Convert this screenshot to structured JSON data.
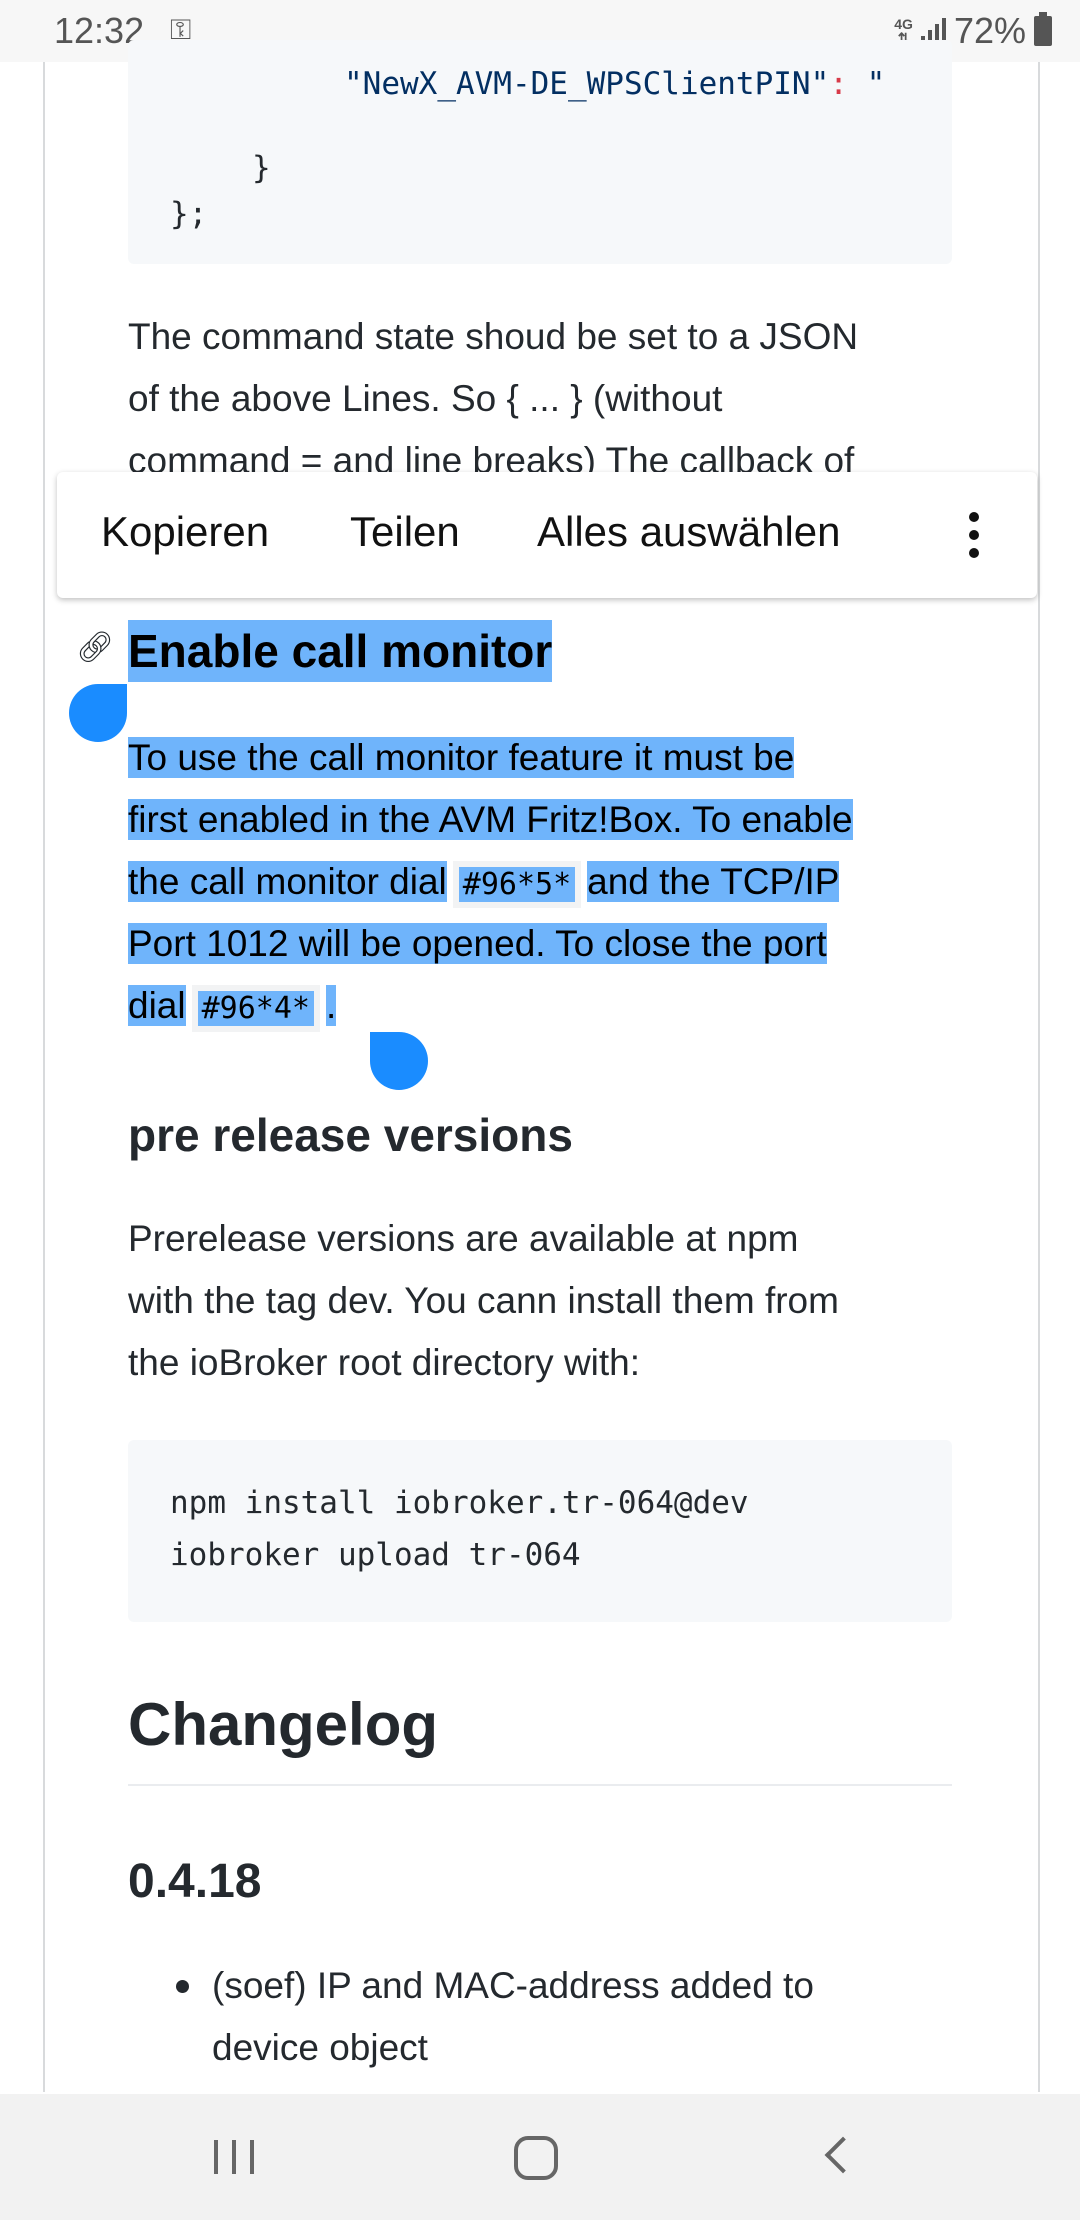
{
  "status_bar": {
    "time": "12:32",
    "network": "4G",
    "battery": "72%",
    "key_icon": "vpn-key-icon"
  },
  "code_top": {
    "line1_key": "\"NewX_AVM-DE_WPSClientPIN\"",
    "line1_colon": ":",
    "line1_rest": " \"",
    "line2": "}",
    "line3": "};"
  },
  "para1": [
    "The command state shoud be set to a JSON",
    "of the above Lines. So { ... } (without",
    "command = and line breaks) The callback of"
  ],
  "selection_menu": {
    "copy": "Kopieren",
    "share": "Teilen",
    "select_all": "Alles auswählen",
    "more_icon": "more-vert-icon"
  },
  "section_call_monitor": {
    "title": "Enable call monitor",
    "line1": "To use the call monitor feature it must be",
    "line2": "first enabled in the AVM Fritz!Box. To enable",
    "line3_a": "the call monitor dial",
    "code_enable": "#96*5*",
    "line3_b": "and the TCP/IP",
    "line4": "Port 1012 will be opened. To close the port",
    "line5_a": "dial",
    "code_close": "#96*4*",
    "line5_b": "."
  },
  "section_prerelease": {
    "title": "pre release versions",
    "lines": [
      "Prerelease versions are available at npm",
      "with the tag dev. You cann install them from",
      "the ioBroker root directory with:"
    ],
    "code": [
      "npm install iobroker.tr-064@dev",
      "iobroker upload tr-064"
    ]
  },
  "changelog": {
    "title": "Changelog",
    "version": "0.4.18",
    "items": [
      {
        "line1": "(soef) IP and MAC-address added to",
        "line2": "device object"
      }
    ]
  },
  "nav_bar": {
    "recents_icon": "recents-icon",
    "home_icon": "home-icon",
    "back_icon": "back-icon"
  },
  "colors": {
    "selection": "#6fb4fb",
    "handle": "#1a8cff",
    "code_bg": "#f6f8fa"
  }
}
